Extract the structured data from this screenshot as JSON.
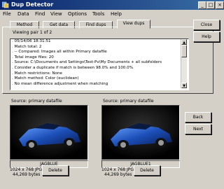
{
  "window": {
    "title": "Dup Detector",
    "controls": [
      "_",
      "□",
      "×"
    ]
  },
  "menu": [
    "File",
    "Data",
    "Find",
    "View",
    "Options",
    "Tools",
    "Help"
  ],
  "tabs": [
    {
      "label": "Method",
      "active": false
    },
    {
      "label": "Get data",
      "active": false
    },
    {
      "label": "Find dups",
      "active": false
    },
    {
      "label": "View dups",
      "active": true
    }
  ],
  "viewing_label": "Viewing pair 1 of 2",
  "log_lines": [
    ". 05/14/06 18:31:51",
    ". Match total: 2",
    ". -- Compared: Images all within Primary datafile",
    ". Total image files: 20",
    ". Source: C:\\Documents and Settings\\Test-Pv\\My Documents + all subfolders",
    ". Consider a duplicate if match is between 98.0% and 100.0%",
    ". Match restrictions: None",
    ". Match method: Color (euclidean)",
    ". No mean difference adjustment when matching"
  ],
  "side_buttons": {
    "close": "Close",
    "help": "Help",
    "back": "Back",
    "next": "Next"
  },
  "images": [
    {
      "source": "Source: primary datafile",
      "name": "JAGBLUE",
      "dims": "1024 x 768 JPG",
      "size": "44,269 bytes",
      "delete": "Delete"
    },
    {
      "source": "Source: primary datafile",
      "name": "JAGBLUE1",
      "dims": "1024 x 768 JPG",
      "size": "44,269 bytes",
      "delete": "Delete"
    }
  ],
  "colors": {
    "title_start": "#0a246a",
    "title_end": "#3a6ea5",
    "face": "#d4d0c8",
    "car": "#1c4fb8"
  }
}
